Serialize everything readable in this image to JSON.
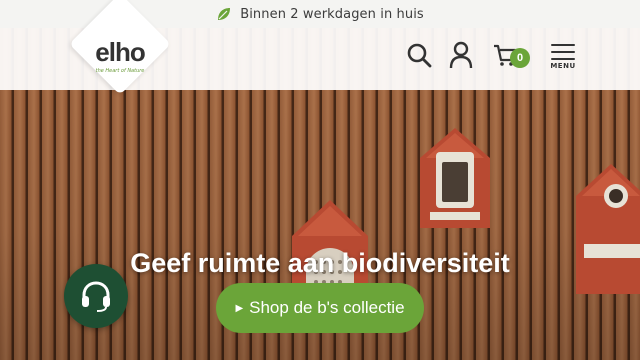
{
  "announcement": {
    "icon": "leaf-icon",
    "text": "Binnen 2 werkdagen in huis"
  },
  "brand": {
    "name": "elho",
    "tagline": "the Heart of Nature",
    "logo_color": "#333333",
    "tagline_color": "#6b9b3a"
  },
  "header": {
    "icons": [
      "search-icon",
      "account-icon",
      "cart-icon"
    ],
    "cart_count": "0",
    "menu_label": "MENU"
  },
  "hero": {
    "title": "Geef ruimte aan biodiversiteit",
    "cta_label": "Shop de b's collectie",
    "cta_color": "#6ba539"
  },
  "support": {
    "icon": "headset-icon",
    "color": "#1e4f33"
  }
}
